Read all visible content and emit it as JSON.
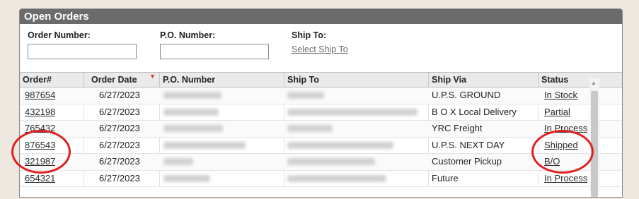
{
  "panel": {
    "title": "Open Orders"
  },
  "filters": {
    "order_number_label": "Order Number:",
    "order_number_value": "",
    "po_number_label": "P.O. Number:",
    "po_number_value": "",
    "ship_to_label": "Ship To:",
    "ship_to_link": "Select Ship To"
  },
  "table": {
    "columns": [
      "Order#",
      "Order Date",
      "P.O. Number",
      "Ship To",
      "Ship Via",
      "Status"
    ],
    "sort_indicator": "▼",
    "rows": [
      {
        "order": "987654",
        "date": "6/27/2023",
        "ship_via": "U.P.S. GROUND",
        "status": "In Stock"
      },
      {
        "order": "432198",
        "date": "6/27/2023",
        "ship_via": "B O X Local Delivery",
        "status": "Partial"
      },
      {
        "order": "765432",
        "date": "6/27/2023",
        "ship_via": "YRC Freight",
        "status": "In Process"
      },
      {
        "order": "876543",
        "date": "6/27/2023",
        "ship_via": "U.P.S. NEXT DAY",
        "status": "Shipped"
      },
      {
        "order": "321987",
        "date": "6/27/2023",
        "ship_via": "Customer Pickup",
        "status": "B/O"
      },
      {
        "order": "654321",
        "date": "6/27/2023",
        "ship_via": "Future",
        "status": "In Process"
      }
    ]
  },
  "colors": {
    "header_bar": "#6b6b6b",
    "highlight_circle": "#e02020",
    "background": "#efe8e0"
  },
  "icons": {
    "scroll_up": "scroll-up-icon",
    "sort": "sort-desc-icon"
  }
}
